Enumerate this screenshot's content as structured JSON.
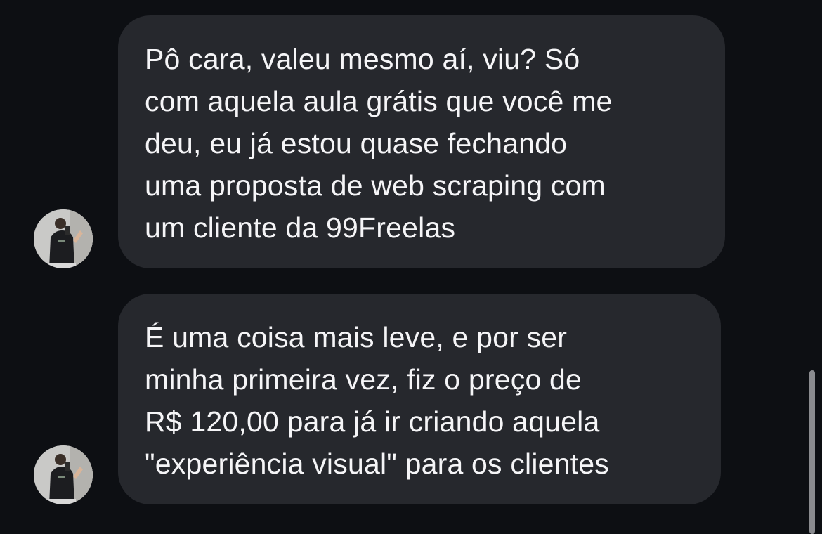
{
  "messages": [
    {
      "sender_avatar": "user-avatar",
      "text": "Pô cara, valeu mesmo aí, viu? Só\ncom aquela aula grátis que você me\ndeu, eu já estou quase fechando\numa proposta de web scraping com\num cliente da 99Freelas"
    },
    {
      "sender_avatar": "user-avatar",
      "text": "É uma coisa mais leve, e por ser\nminha primeira vez, fiz o preço de\nR$ 120,00 para já ir criando aquela\n\"experiência visual\" para os clientes"
    }
  ],
  "colors": {
    "background": "#0d0f13",
    "bubble": "#26282d",
    "text": "#f5f5f7",
    "scrollbar": "#8a8b8f"
  }
}
